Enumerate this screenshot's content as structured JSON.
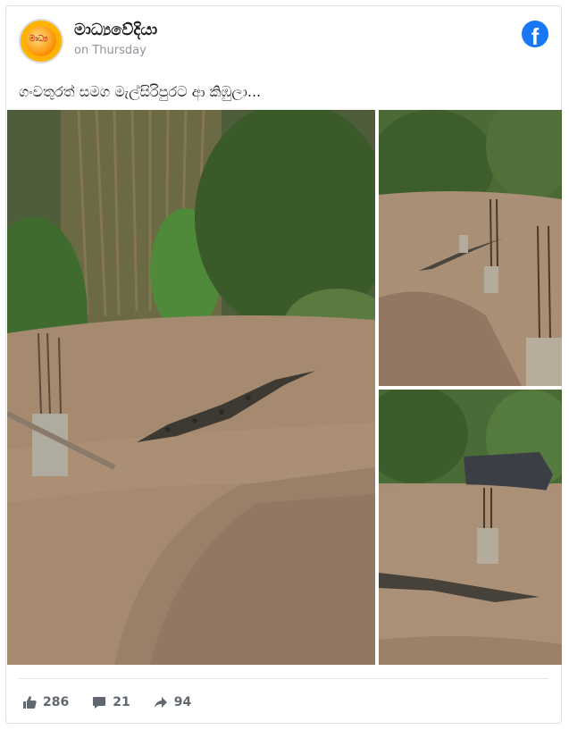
{
  "post": {
    "page_name": "මාධ්‍යවේදියා",
    "time": "on Thursday",
    "caption": "ගංවතුරත් සමග මැල්සිරිපුරට ආ කිඹුලා...",
    "avatar_text": "මාධ්‍ය"
  },
  "stats": {
    "likes": "286",
    "comments": "21",
    "shares": "94"
  },
  "colors": {
    "facebook_blue": "#1877f2",
    "text_primary": "#1c1e21",
    "text_secondary": "#90949c",
    "floodwater": "#a58a70"
  },
  "icons": {
    "facebook": "facebook-icon",
    "like": "thumbs-up-icon",
    "comment": "comment-icon",
    "share": "share-arrow-icon"
  }
}
